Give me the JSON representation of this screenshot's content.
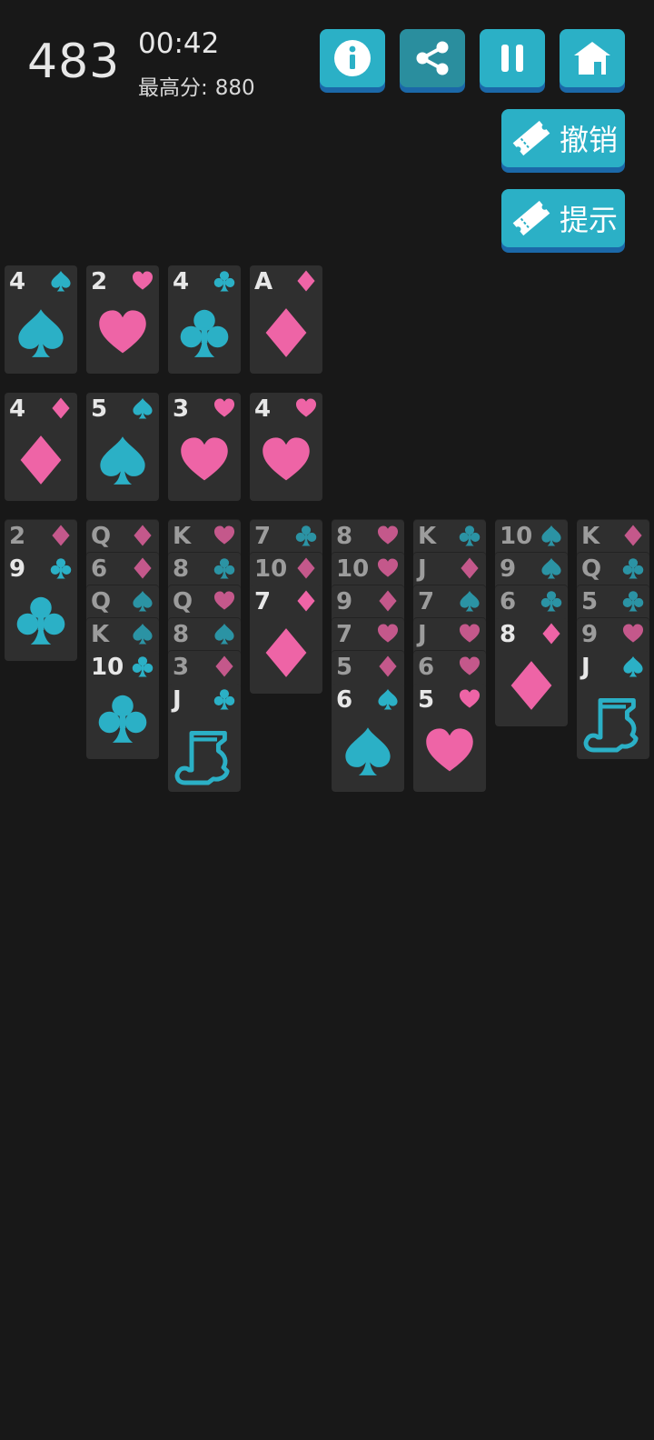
{
  "header": {
    "score": "483",
    "timer": "00:42",
    "best_label": "最高分:",
    "best_value": "880"
  },
  "toolbar": {
    "info_icon": "info-icon",
    "share_icon": "share-icon",
    "pause_icon": "pause-icon",
    "home_icon": "home-icon",
    "undo_label": "撤销",
    "hint_label": "提示"
  },
  "colors": {
    "red_suit": "#ee64a6",
    "black_suit": "#2bb0c6",
    "card_bg": "#2f2f2f",
    "button": "#2bb0c6",
    "button_shadow": "#1b68a8",
    "background": "#181818"
  },
  "foundations": [
    {
      "rank": "4",
      "suit": "spade"
    },
    {
      "rank": "2",
      "suit": "heart"
    },
    {
      "rank": "4",
      "suit": "club"
    },
    {
      "rank": "A",
      "suit": "diamond"
    }
  ],
  "free_cells": [
    {
      "rank": "4",
      "suit": "diamond"
    },
    {
      "rank": "5",
      "suit": "spade"
    },
    {
      "rank": "3",
      "suit": "heart"
    },
    {
      "rank": "4",
      "suit": "heart"
    }
  ],
  "tableau": [
    [
      {
        "rank": "2",
        "suit": "diamond"
      },
      {
        "rank": "9",
        "suit": "club"
      }
    ],
    [
      {
        "rank": "Q",
        "suit": "diamond"
      },
      {
        "rank": "6",
        "suit": "diamond"
      },
      {
        "rank": "Q",
        "suit": "spade"
      },
      {
        "rank": "K",
        "suit": "spade"
      },
      {
        "rank": "10",
        "suit": "club"
      }
    ],
    [
      {
        "rank": "K",
        "suit": "heart"
      },
      {
        "rank": "8",
        "suit": "club"
      },
      {
        "rank": "Q",
        "suit": "heart"
      },
      {
        "rank": "8",
        "suit": "spade"
      },
      {
        "rank": "3",
        "suit": "diamond"
      },
      {
        "rank": "J",
        "suit": "club"
      }
    ],
    [
      {
        "rank": "7",
        "suit": "club"
      },
      {
        "rank": "10",
        "suit": "diamond"
      },
      {
        "rank": "7",
        "suit": "diamond"
      }
    ],
    [
      {
        "rank": "8",
        "suit": "heart"
      },
      {
        "rank": "10",
        "suit": "heart"
      },
      {
        "rank": "9",
        "suit": "diamond"
      },
      {
        "rank": "7",
        "suit": "heart"
      },
      {
        "rank": "5",
        "suit": "diamond"
      },
      {
        "rank": "6",
        "suit": "spade"
      }
    ],
    [
      {
        "rank": "K",
        "suit": "club"
      },
      {
        "rank": "J",
        "suit": "diamond"
      },
      {
        "rank": "7",
        "suit": "spade"
      },
      {
        "rank": "J",
        "suit": "heart"
      },
      {
        "rank": "6",
        "suit": "heart"
      },
      {
        "rank": "5",
        "suit": "heart"
      }
    ],
    [
      {
        "rank": "10",
        "suit": "spade"
      },
      {
        "rank": "9",
        "suit": "spade"
      },
      {
        "rank": "6",
        "suit": "club"
      },
      {
        "rank": "8",
        "suit": "diamond"
      }
    ],
    [
      {
        "rank": "K",
        "suit": "diamond"
      },
      {
        "rank": "Q",
        "suit": "club"
      },
      {
        "rank": "5",
        "suit": "club"
      },
      {
        "rank": "9",
        "suit": "heart"
      },
      {
        "rank": "J",
        "suit": "spade"
      }
    ]
  ]
}
